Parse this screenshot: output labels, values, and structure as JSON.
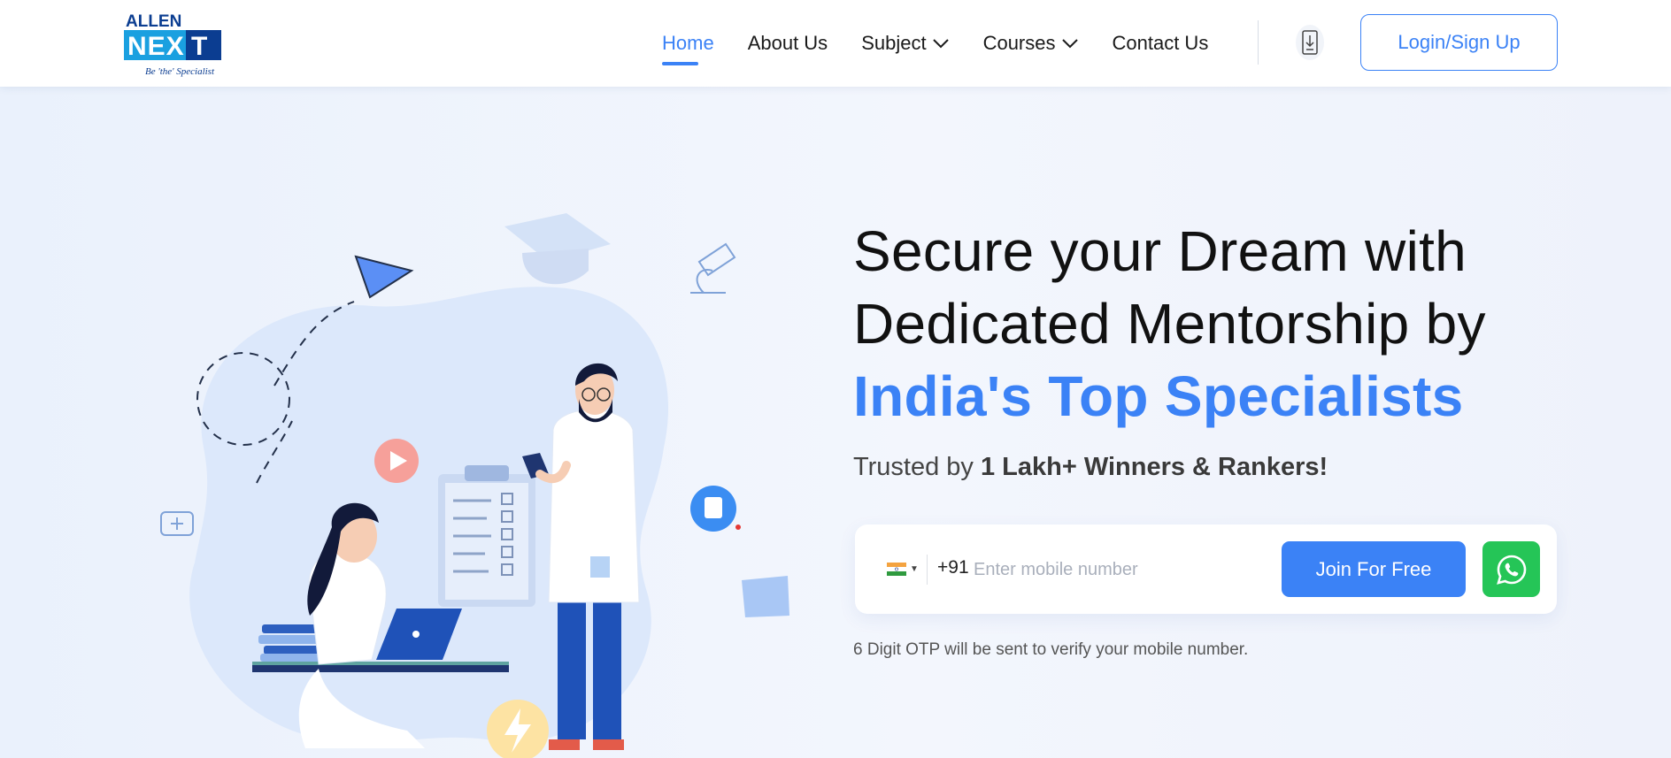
{
  "brand": {
    "top": "ALLEN",
    "name": "NEXT",
    "tagline": "Be 'the' Specialist",
    "colors": {
      "navy": "#0b3d91",
      "cyan": "#1aa0e0"
    }
  },
  "nav": {
    "items": [
      {
        "label": "Home",
        "active": true
      },
      {
        "label": "About Us"
      },
      {
        "label": "Subject",
        "has_dropdown": true
      },
      {
        "label": "Courses",
        "has_dropdown": true
      },
      {
        "label": "Contact Us"
      }
    ],
    "app_download_icon": "download-app-icon",
    "login_label": "Login/Sign Up"
  },
  "hero": {
    "headline_line1": "Secure your Dream with",
    "headline_line2": "Dedicated Mentorship by",
    "headline_highlight": "India's Top Specialists",
    "trusted_prefix": "Trusted by ",
    "trusted_bold": "1 Lakh+ Winners & Rankers!",
    "form": {
      "country_code": "+91",
      "phone_placeholder": "Enter mobile number",
      "join_label": "Join For Free",
      "whatsapp_icon": "whatsapp-icon"
    },
    "otp_note": "6 Digit OTP will be sent to verify your mobile number."
  },
  "colors": {
    "accent": "#3b82f6",
    "whatsapp": "#25c557",
    "background": "#eef3fc"
  }
}
